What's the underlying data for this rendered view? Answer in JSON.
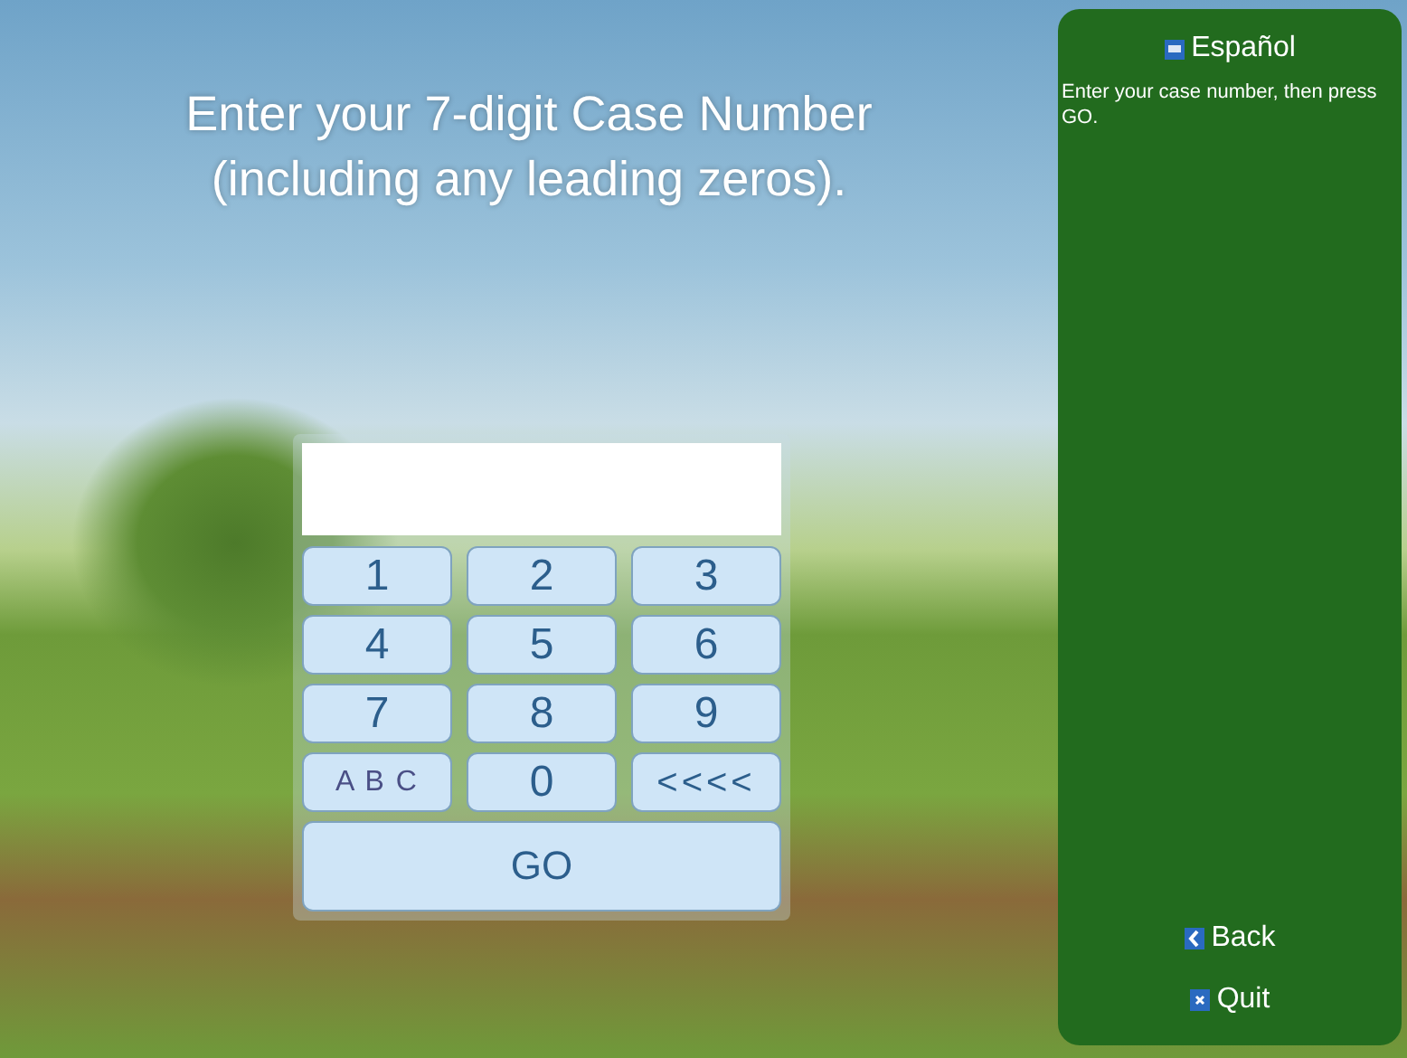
{
  "heading": {
    "lines": [
      "Enter your 7-digit Case Number",
      "(including any leading zeros)."
    ]
  },
  "keypad": {
    "keys": [
      {
        "label": "1",
        "kind": "digit"
      },
      {
        "label": "2",
        "kind": "digit"
      },
      {
        "label": "3",
        "kind": "digit"
      },
      {
        "label": "4",
        "kind": "digit"
      },
      {
        "label": "5",
        "kind": "digit"
      },
      {
        "label": "6",
        "kind": "digit"
      },
      {
        "label": "7",
        "kind": "digit"
      },
      {
        "label": "8",
        "kind": "digit"
      },
      {
        "label": "9",
        "kind": "digit"
      },
      {
        "label": "A B C",
        "kind": "letters"
      },
      {
        "label": "0",
        "kind": "digit"
      },
      {
        "label": "<<<<",
        "kind": "backspace"
      },
      {
        "label": "GO",
        "kind": "submit"
      }
    ]
  },
  "sidebar": {
    "language": "Español",
    "instructions": "Enter your case number, then press GO.",
    "actions": [
      {
        "label": "Back",
        "kind": "back"
      },
      {
        "label": "Quit",
        "kind": "quit"
      }
    ]
  }
}
